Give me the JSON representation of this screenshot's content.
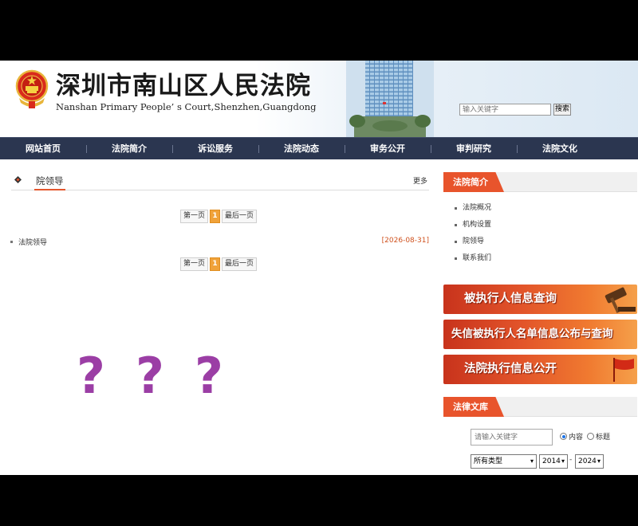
{
  "header": {
    "title": "深圳市南山区人民法院",
    "subtitle": "Nanshan Primary People’ s Court,Shenzhen,Guangdong",
    "search_placeholder": "输入关键字",
    "search_button": "搜索"
  },
  "nav": {
    "items": [
      {
        "label": "网站首页"
      },
      {
        "label": "法院简介"
      },
      {
        "label": "诉讼服务"
      },
      {
        "label": "法院动态"
      },
      {
        "label": "审务公开"
      },
      {
        "label": "审判研究"
      },
      {
        "label": "法院文化"
      }
    ]
  },
  "main": {
    "section_title": "院领导",
    "more_label": "更多",
    "pager": {
      "first": "第一页",
      "current": "1",
      "last": "最后一页"
    },
    "items": [
      {
        "title": "法院领导",
        "date": "[2026-08-31]"
      }
    ],
    "overlay_marks": [
      "?",
      "?",
      "?"
    ]
  },
  "sidebar": {
    "intro_title": "法院简介",
    "intro_items": [
      {
        "label": "法院概况"
      },
      {
        "label": "机构设置"
      },
      {
        "label": "院领导"
      },
      {
        "label": "联系我们"
      }
    ],
    "banners": [
      {
        "label": "被执行人信息查询"
      },
      {
        "label": "失信被执行人名单信息公布与查询"
      },
      {
        "label": "法院执行信息公开"
      }
    ],
    "library": {
      "title": "法律文库",
      "search_placeholder": "请输入关键字",
      "radio_content": "内容",
      "radio_title": "标题",
      "type_select": "所有类型",
      "year_from": "2014",
      "year_to": "2024",
      "separator": "-"
    }
  },
  "colors": {
    "nav_bg": "#2b3650",
    "accent": "#e8542c",
    "pager_current": "#f0a23a",
    "date": "#d0521e",
    "question_marks": "#9b3ea5"
  }
}
